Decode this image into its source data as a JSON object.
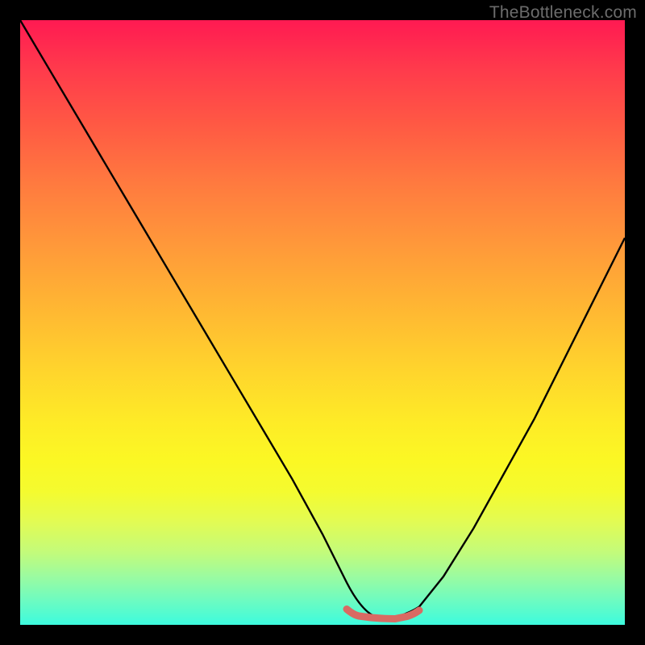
{
  "watermark": "TheBottleneck.com",
  "chart_data": {
    "type": "line",
    "title": "",
    "xlabel": "",
    "ylabel": "",
    "xlim": [
      0,
      100
    ],
    "ylim": [
      0,
      100
    ],
    "grid": false,
    "legend": false,
    "series": [
      {
        "name": "bottleneck-curve",
        "x": [
          0,
          5,
          10,
          15,
          20,
          25,
          30,
          35,
          40,
          45,
          50,
          52,
          54,
          56,
          58,
          60,
          62,
          64,
          66,
          70,
          75,
          80,
          85,
          90,
          95,
          100
        ],
        "y": [
          100,
          91.6,
          83.1,
          74.7,
          66.2,
          57.8,
          49.3,
          40.9,
          32.4,
          24.0,
          15.0,
          11.0,
          7.0,
          3.0,
          1.0,
          0.5,
          0.5,
          1.0,
          3.0,
          8.0,
          16.0,
          25.0,
          34.0,
          44.0,
          54.0,
          64.0
        ]
      },
      {
        "name": "bottom-highlight",
        "x": [
          54,
          56,
          58,
          60,
          62,
          64,
          66
        ],
        "y": [
          2.6,
          1.6,
          1.2,
          1.0,
          1.0,
          1.4,
          2.4
        ]
      }
    ],
    "colors": {
      "curve": "#000000",
      "highlight": "#d96a63",
      "gradient_top": "#ff1a52",
      "gradient_bottom": "#3dfbde"
    }
  }
}
